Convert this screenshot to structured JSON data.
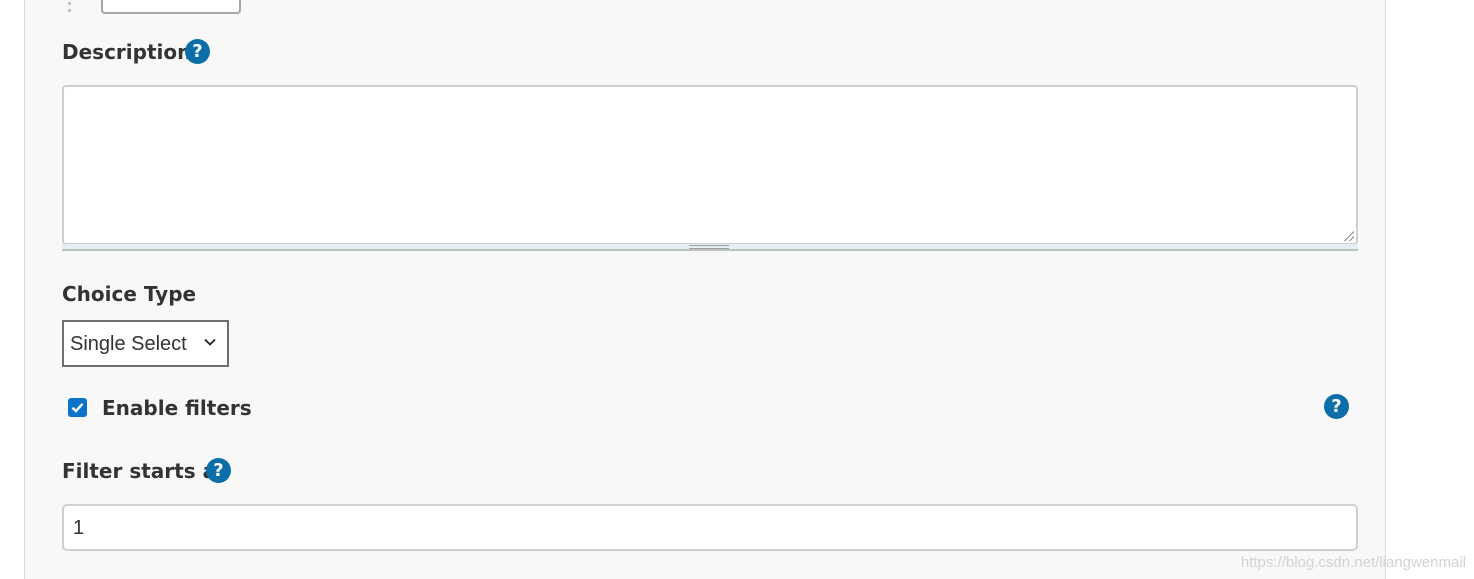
{
  "description": {
    "label": "Description",
    "help_icon": "question-circle-icon",
    "value": ""
  },
  "choice_type": {
    "label": "Choice Type",
    "selected": "Single Select",
    "dropdown_icon": "chevron-down-icon"
  },
  "enable_filters": {
    "label": "Enable filters",
    "checked": true,
    "help_icon": "question-circle-icon"
  },
  "filter_starts_at": {
    "label": "Filter starts at",
    "help_icon": "question-circle-icon",
    "value": "1"
  },
  "help_glyph": "?",
  "watermark": "https://blog.csdn.net/liangwenmail",
  "colors": {
    "accent": "#0b6ea8",
    "checkbox": "#0b74c9",
    "panel_bg": "#f8f8f8"
  }
}
